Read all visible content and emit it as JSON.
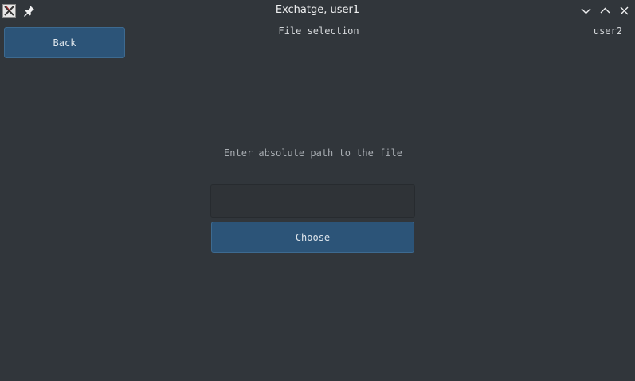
{
  "window": {
    "title": "Exchatge, user1"
  },
  "icons": {
    "app": "app-x-icon",
    "pin": "pin-icon",
    "minimize": "chevron-down-icon",
    "maximize": "chevron-up-icon",
    "close": "close-icon"
  },
  "header": {
    "back_label": "Back",
    "page_title": "File selection",
    "user": "user2"
  },
  "main": {
    "prompt": "Enter absolute path to the file",
    "path_value": "",
    "path_placeholder": "",
    "choose_label": "Choose"
  },
  "colors": {
    "background": "#31363b",
    "button": "#2c5478",
    "text": "#eff0f1"
  }
}
